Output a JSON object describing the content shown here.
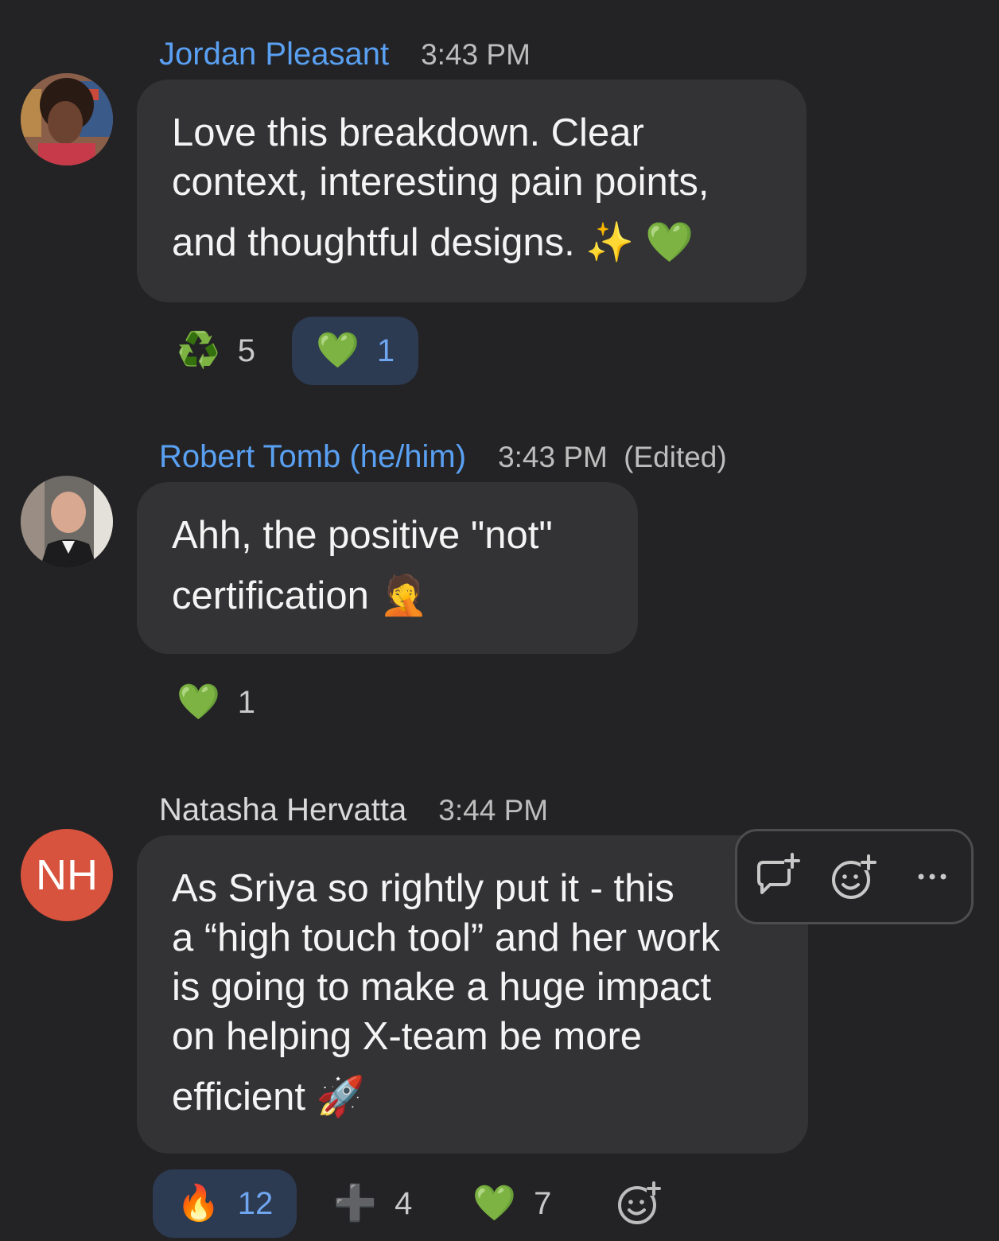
{
  "messages": [
    {
      "author": "Jordan Pleasant",
      "time": "3:43 PM",
      "lines": [
        "Love this breakdown. Clear",
        "context, interesting pain points,",
        "and thoughtful designs. ✨ 💚"
      ],
      "reactions": [
        {
          "emoji": "♻️",
          "count": "5",
          "active": false
        },
        {
          "emoji": "💚",
          "count": "1",
          "active": true
        }
      ]
    },
    {
      "author": "Robert Tomb (he/him)",
      "time": "3:43 PM",
      "edited": "(Edited)",
      "lines": [
        "Ahh, the positive \"not\"",
        "certification 🤦"
      ],
      "reactions": [
        {
          "emoji": "💚",
          "count": "1",
          "active": false
        }
      ]
    },
    {
      "author": "Natasha Hervatta",
      "time": "3:44 PM",
      "avatar_initials": "NH",
      "lines": [
        "As Sriya so rightly put it - this",
        "a “high touch tool” and her work",
        "is going to make a huge impact",
        "on helping X-team be more",
        "efficient 🚀"
      ],
      "reactions": [
        {
          "emoji": "🔥",
          "count": "12",
          "active": true
        },
        {
          "emoji": "➕",
          "count": "4",
          "active": false
        },
        {
          "emoji": "💚",
          "count": "7",
          "active": false
        }
      ]
    }
  ],
  "toolbar": {
    "icons": [
      "reply-thread-icon",
      "add-reaction-icon",
      "more-options-icon"
    ]
  },
  "colors": {
    "background": "#232325",
    "bubble": "#333335",
    "author_link": "#5aa0f2",
    "active_reaction_bg": "#2c3a52",
    "active_reaction_text": "#6fa6ef",
    "avatar_nh": "#d8533e"
  }
}
